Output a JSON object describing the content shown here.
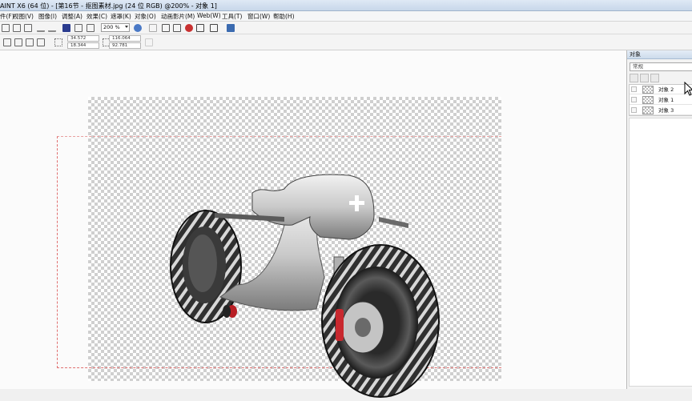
{
  "window": {
    "title": "AINT X6 (64 位) - [第16节 - 抠图素材.jpg (24 位 RGB) @200% - 对象 1]"
  },
  "menu": {
    "items": [
      {
        "label": "件(F)"
      },
      {
        "label": "视图(V)"
      },
      {
        "label": "图像(I)"
      },
      {
        "label": "调整(A)"
      },
      {
        "label": "效果(C)"
      },
      {
        "label": "遮罩(K)"
      },
      {
        "label": "对象(O)"
      },
      {
        "label": "动画影片(M)"
      },
      {
        "label": "Web(W)"
      },
      {
        "label": "工具(T)"
      },
      {
        "label": "窗口(W)"
      },
      {
        "label": "帮助(H)"
      }
    ]
  },
  "toolbar": {
    "zoom_value": "200 %"
  },
  "property_bar": {
    "x": "34.572",
    "y": "18.344",
    "width": "116.064",
    "height": "92.781"
  },
  "objects_panel": {
    "title": "对象",
    "mode": "常规",
    "layers": [
      {
        "label": "对象 2"
      },
      {
        "label": "对象 1"
      },
      {
        "label": "对象 3"
      }
    ]
  },
  "colors": {
    "menu_highlight": "#1d61c4",
    "title_gradient": "#c7d7ea",
    "checker": "#cfcfcf"
  }
}
